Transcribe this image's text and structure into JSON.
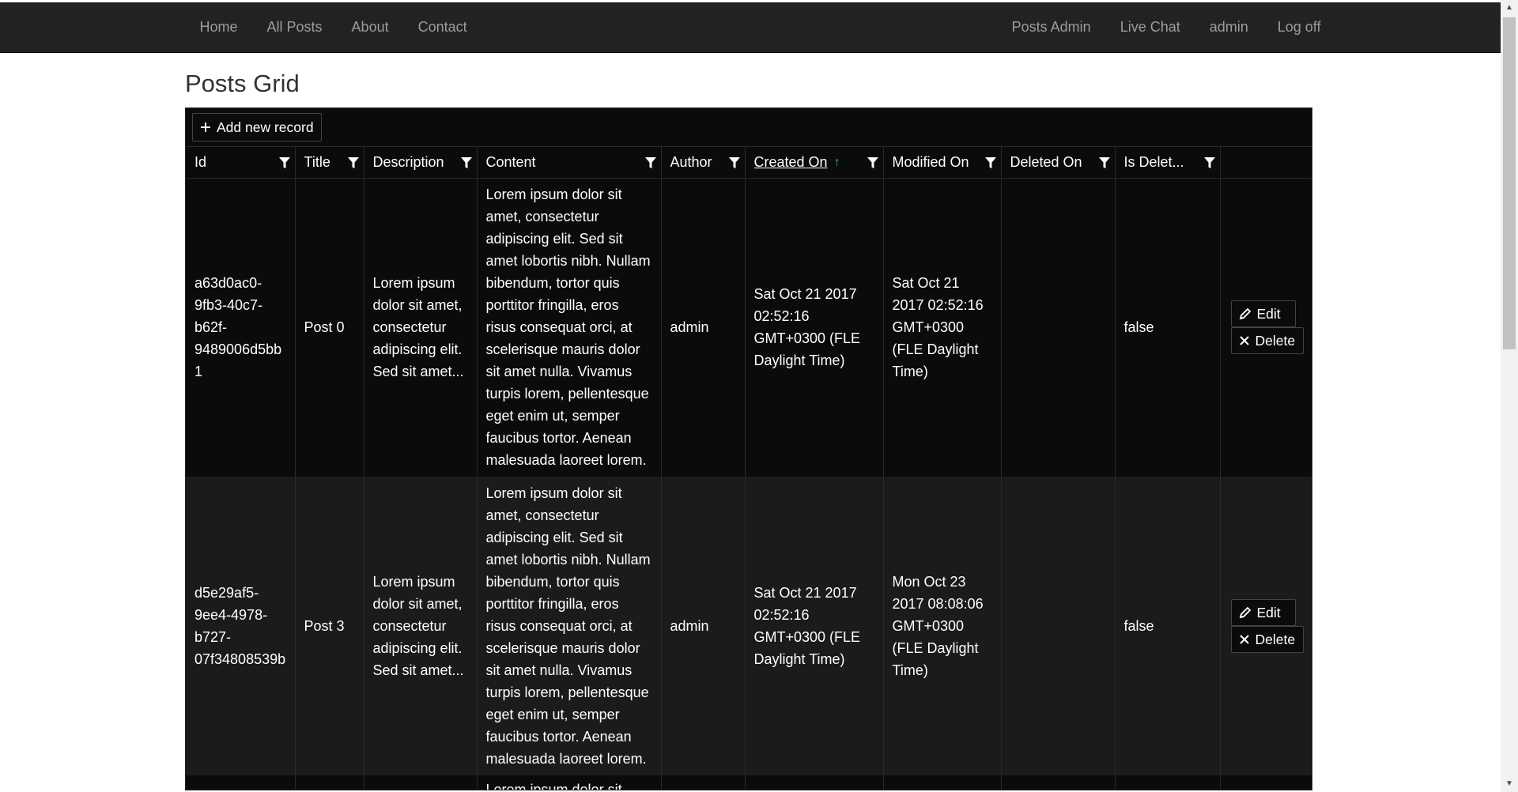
{
  "nav": {
    "left": [
      "Home",
      "All Posts",
      "About",
      "Contact"
    ],
    "right": [
      "Posts Admin",
      "Live Chat",
      "admin",
      "Log off"
    ]
  },
  "page": {
    "title": "Posts Grid"
  },
  "grid": {
    "add_label": "Add new record",
    "columns": [
      "Id",
      "Title",
      "Description",
      "Content",
      "Author",
      "Created On",
      "Modified On",
      "Deleted On",
      "Is Delet..."
    ],
    "sorted_column": "Created On",
    "sort_direction": "ascending",
    "rows": [
      {
        "id": "a63d0ac0-9fb3-40c7-b62f-9489006d5bb1",
        "title": "Post 0",
        "description": "Lorem ipsum dolor sit amet, consectetur adipiscing elit. Sed sit amet...",
        "content": "Lorem ipsum dolor sit amet, consectetur adipiscing elit. Sed sit amet lobortis nibh. Nullam bibendum, tortor quis porttitor fringilla, eros risus consequat orci, at scelerisque mauris dolor sit amet nulla. Vivamus turpis lorem, pellentesque eget enim ut, semper faucibus tortor. Aenean malesuada laoreet lorem.",
        "author": "admin",
        "created_on": "Sat Oct 21 2017 02:52:16 GMT+0300 (FLE Daylight Time)",
        "modified_on": "Sat Oct 21 2017 02:52:16 GMT+0300 (FLE Daylight Time)",
        "deleted_on": "",
        "is_deleted": "false"
      },
      {
        "id": "d5e29af5-9ee4-4978-b727-07f34808539b",
        "title": "Post 3",
        "description": "Lorem ipsum dolor sit amet, consectetur adipiscing elit. Sed sit amet...",
        "content": "Lorem ipsum dolor sit amet, consectetur adipiscing elit. Sed sit amet lobortis nibh. Nullam bibendum, tortor quis porttitor fringilla, eros risus consequat orci, at scelerisque mauris dolor sit amet nulla. Vivamus turpis lorem, pellentesque eget enim ut, semper faucibus tortor. Aenean malesuada laoreet lorem.",
        "author": "admin",
        "created_on": "Sat Oct 21 2017 02:52:16 GMT+0300 (FLE Daylight Time)",
        "modified_on": "Mon Oct 23 2017 08:08:06 GMT+0300 (FLE Daylight Time)",
        "deleted_on": "",
        "is_deleted": "false"
      }
    ],
    "partial_row_content": "Lorem ipsum dolor sit",
    "edit_label": "Edit",
    "delete_label": "Delete"
  },
  "colors": {
    "navbar": "#222222",
    "nav_text": "#9d9d9d",
    "grid_bg": "#0b0b0b",
    "grid_alt_bg": "#1b1b1b",
    "sort_arrow": "#20b2aa"
  },
  "icons": {
    "filter": "filter-icon",
    "add": "plus-icon",
    "edit": "pencil-icon",
    "delete": "close-icon",
    "sort": "sort-asc-icon"
  }
}
